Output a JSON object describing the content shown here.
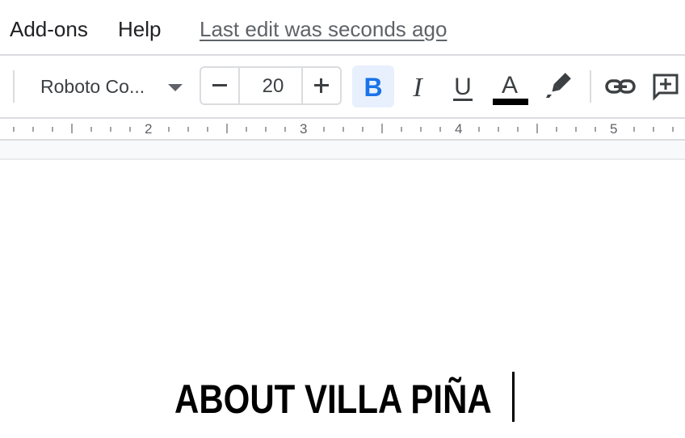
{
  "menubar": {
    "items": [
      {
        "label": "Add-ons"
      },
      {
        "label": "Help"
      }
    ],
    "last_edit": "Last edit was seconds ago"
  },
  "toolbar": {
    "font_name": "Roboto Co...",
    "font_size": "20",
    "bold_label": "B",
    "italic_label": "I",
    "underline_label": "U",
    "text_color_label": "A",
    "text_color": "#000000",
    "bold_active_bg": "#e8f0fe",
    "bold_color": "#1a73e8",
    "icons": [
      "decrease-font-size-icon",
      "increase-font-size-icon",
      "bold-icon",
      "italic-icon",
      "underline-icon",
      "text-color-icon",
      "highlight-pen-icon",
      "link-icon",
      "add-comment-icon"
    ]
  },
  "ruler": {
    "numbers": [
      "2",
      "3",
      "4",
      "5"
    ]
  },
  "document": {
    "heading": "ABOUT VILLA PIÑA"
  }
}
